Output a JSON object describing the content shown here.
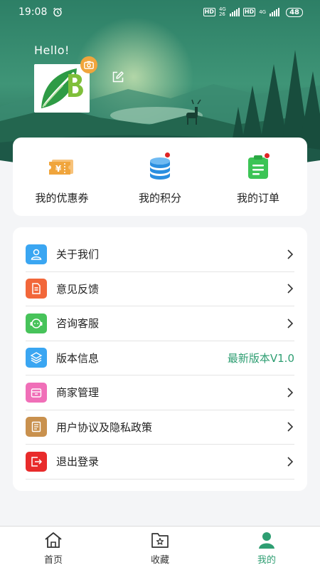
{
  "status_bar": {
    "time": "19:08",
    "hd1": "HD",
    "net1_top": "4G",
    "net1_bottom": "26",
    "hd2": "HD",
    "net2_top": "4G",
    "battery": "48"
  },
  "profile": {
    "greeting": "Hello!",
    "avatar_letter": "B"
  },
  "quick_actions": [
    {
      "label": "我的优惠券",
      "icon": "coupon-icon",
      "color": "#f0a53c"
    },
    {
      "label": "我的积分",
      "icon": "points-coins-icon",
      "color": "#2b8fe0"
    },
    {
      "label": "我的订单",
      "icon": "order-list-icon",
      "color": "#3cc455"
    }
  ],
  "menu": {
    "items": [
      {
        "label": "关于我们",
        "icon": "user-icon",
        "color": "#3aa6f2"
      },
      {
        "label": "意见反馈",
        "icon": "document-icon",
        "color": "#f2673a"
      },
      {
        "label": "咨询客服",
        "icon": "customer-service-icon",
        "color": "#47c35a"
      },
      {
        "label": "版本信息",
        "icon": "layers-icon",
        "color": "#3aa6f2",
        "value": "最新版本V1.0"
      },
      {
        "label": "商家管理",
        "icon": "store-icon",
        "color": "#f06fb8"
      },
      {
        "label": "用户协议及隐私政策",
        "icon": "agreement-icon",
        "color": "#c9914e"
      },
      {
        "label": "退出登录",
        "icon": "logout-icon",
        "color": "#e82b2b"
      }
    ]
  },
  "bottom_nav": [
    {
      "label": "首页",
      "icon": "home-icon",
      "active": false
    },
    {
      "label": "收藏",
      "icon": "favorites-folder-icon",
      "active": false
    },
    {
      "label": "我的",
      "icon": "profile-icon",
      "active": true
    }
  ],
  "colors": {
    "accent": "#2e9e72",
    "header_dark": "#1c5a4c"
  }
}
